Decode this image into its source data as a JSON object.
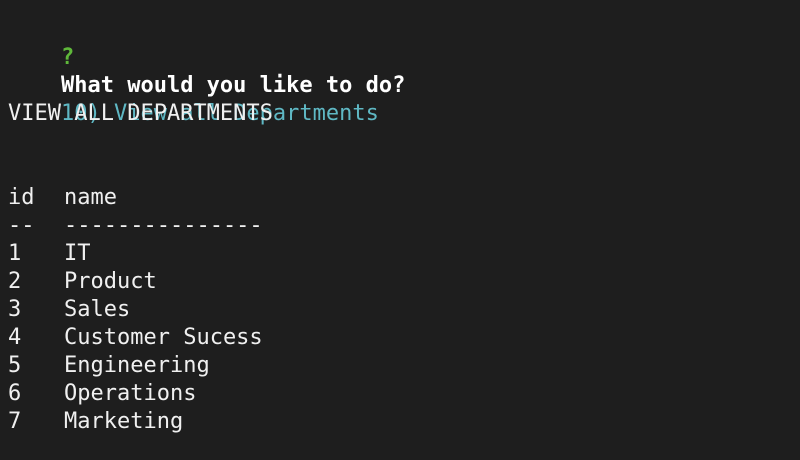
{
  "prompt": {
    "marker": "?",
    "question": "What would you like to do?",
    "answer": "10) View all Departments"
  },
  "section_title": "VIEW ALL DEPARTMENTS",
  "table": {
    "headers": {
      "id": "id",
      "name": "name"
    },
    "separators": {
      "id": "--",
      "name": "---------------"
    },
    "rows": [
      {
        "id": "1",
        "name": "IT"
      },
      {
        "id": "2",
        "name": "Product"
      },
      {
        "id": "3",
        "name": "Sales"
      },
      {
        "id": "4",
        "name": "Customer Sucess"
      },
      {
        "id": "5",
        "name": "Engineering"
      },
      {
        "id": "6",
        "name": "Operations"
      },
      {
        "id": "7",
        "name": "Marketing"
      }
    ]
  }
}
